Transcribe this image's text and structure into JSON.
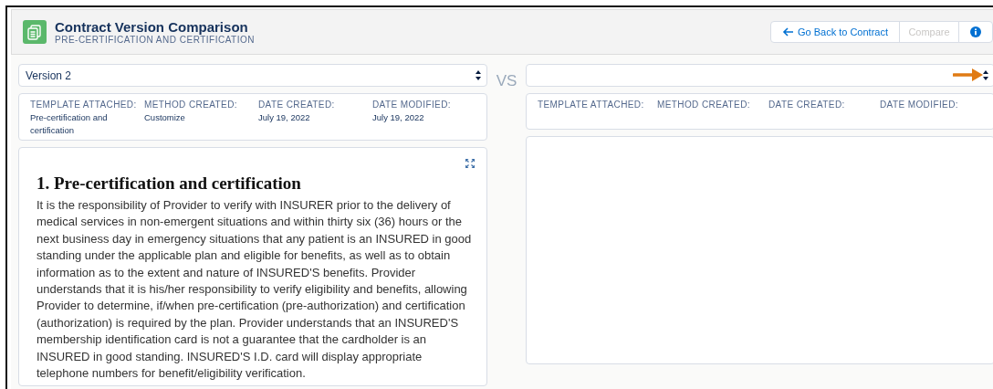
{
  "header": {
    "title": "Contract Version Comparison",
    "subtitle": "PRE-CERTIFICATION AND CERTIFICATION"
  },
  "buttons": [
    {
      "kind": "back",
      "label": "Go Back to Contract",
      "disabled": false
    },
    {
      "kind": "text",
      "label": "Compare",
      "disabled": true
    },
    {
      "kind": "info",
      "disabled": false
    }
  ],
  "separator": "VS",
  "versions": [
    {
      "select": {
        "value": "Version 2"
      },
      "fields": [
        {
          "label": "TEMPLATE ATTACHED:",
          "value": "Pre-certification and certification"
        },
        {
          "label": "METHOD CREATED:",
          "value": "Customize"
        },
        {
          "label": "DATE CREATED:",
          "value": "July 19, 2022"
        },
        {
          "label": "DATE MODIFIED:",
          "value": "July 19, 2022"
        }
      ],
      "document": {
        "heading": "1. Pre-certification and certification",
        "body": "It is the responsibility of Provider to verify with INSURER prior to the delivery of medical services in non-emergent situations and within thirty six (36) hours or the next business day in emergency situations that any patient is an INSURED in good standing under the applicable plan and eligible for benefits, as well as to obtain information as to the extent and nature of INSURED'S benefits. Provider understands that it is his/her responsibility to verify eligibility and benefits, allowing Provider to determine, if/when pre-certification (pre-authorization) and certification (authorization) is required by the plan. Provider understands that an INSURED'S membership identification card is not a guarantee that the cardholder is an INSURED in good standing. INSURED'S I.D. card will display appropriate telephone numbers for benefit/eligibility verification."
      }
    },
    {
      "select": {
        "annotated": true
      },
      "fields": [
        {
          "label": "TEMPLATE ATTACHED:"
        },
        {
          "label": "METHOD CREATED:"
        },
        {
          "label": "DATE CREATED:"
        },
        {
          "label": "DATE MODIFIED:"
        }
      ]
    }
  ]
}
